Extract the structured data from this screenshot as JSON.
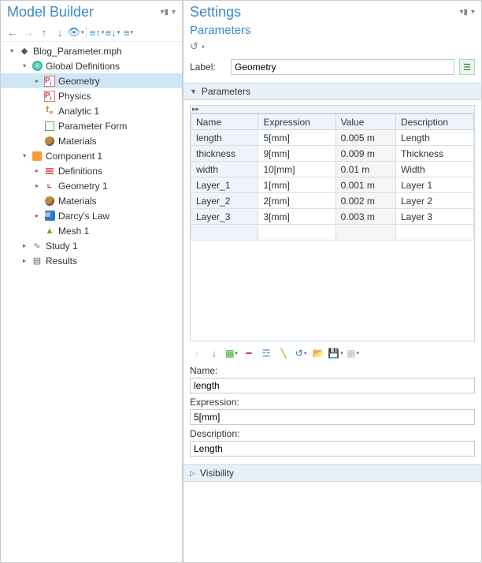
{
  "left": {
    "title": "Model Builder",
    "tree": [
      {
        "d": 0,
        "exp": "▾",
        "icon": "root",
        "label": "Blog_Parameter.mph"
      },
      {
        "d": 1,
        "exp": "▾",
        "icon": "globe",
        "label": "Global Definitions"
      },
      {
        "d": 2,
        "exp": "▸",
        "icon": "pi",
        "label": "Geometry",
        "sel": true
      },
      {
        "d": 2,
        "exp": "",
        "icon": "pi",
        "label": "Physics"
      },
      {
        "d": 2,
        "exp": "",
        "icon": "fx",
        "label": "Analytic 1"
      },
      {
        "d": 2,
        "exp": "",
        "icon": "form",
        "label": "Parameter Form"
      },
      {
        "d": 2,
        "exp": "",
        "icon": "mat",
        "label": "Materials"
      },
      {
        "d": 1,
        "exp": "▾",
        "icon": "comp",
        "label": "Component 1"
      },
      {
        "d": 2,
        "exp": "▸",
        "icon": "def",
        "label": "Definitions"
      },
      {
        "d": 2,
        "exp": "▸",
        "icon": "geom",
        "label": "Geometry 1"
      },
      {
        "d": 2,
        "exp": "",
        "icon": "mat",
        "label": "Materials"
      },
      {
        "d": 2,
        "exp": "▸",
        "icon": "law",
        "label": "Darcy's Law"
      },
      {
        "d": 2,
        "exp": "",
        "icon": "mesh",
        "label": "Mesh 1"
      },
      {
        "d": 1,
        "exp": "▸",
        "icon": "study",
        "label": "Study 1"
      },
      {
        "d": 1,
        "exp": "▸",
        "icon": "res",
        "label": "Results"
      }
    ]
  },
  "right": {
    "title": "Settings",
    "subtitle": "Parameters",
    "labelField": {
      "caption": "Label:",
      "value": "Geometry"
    },
    "sectionParams": "Parameters",
    "sectionVis": "Visibility",
    "cols": [
      "Name",
      "Expression",
      "Value",
      "Description"
    ],
    "rows": [
      {
        "n": "length",
        "e": "5[mm]",
        "v": "0.005 m",
        "d": "Length"
      },
      {
        "n": "thickness",
        "e": "9[mm]",
        "v": "0.009 m",
        "d": "Thickness"
      },
      {
        "n": "width",
        "e": "10[mm]",
        "v": "0.01 m",
        "d": "Width"
      },
      {
        "n": "Layer_1",
        "e": "1[mm]",
        "v": "0.001 m",
        "d": "Layer 1"
      },
      {
        "n": "Layer_2",
        "e": "2[mm]",
        "v": "0.002 m",
        "d": "Layer 2"
      },
      {
        "n": "Layer_3",
        "e": "3[mm]",
        "v": "0.003 m",
        "d": "Layer 3"
      }
    ],
    "fields": {
      "name": {
        "label": "Name:",
        "value": "length"
      },
      "expr": {
        "label": "Expression:",
        "value": "5[mm]"
      },
      "desc": {
        "label": "Description:",
        "value": "Length"
      }
    }
  }
}
